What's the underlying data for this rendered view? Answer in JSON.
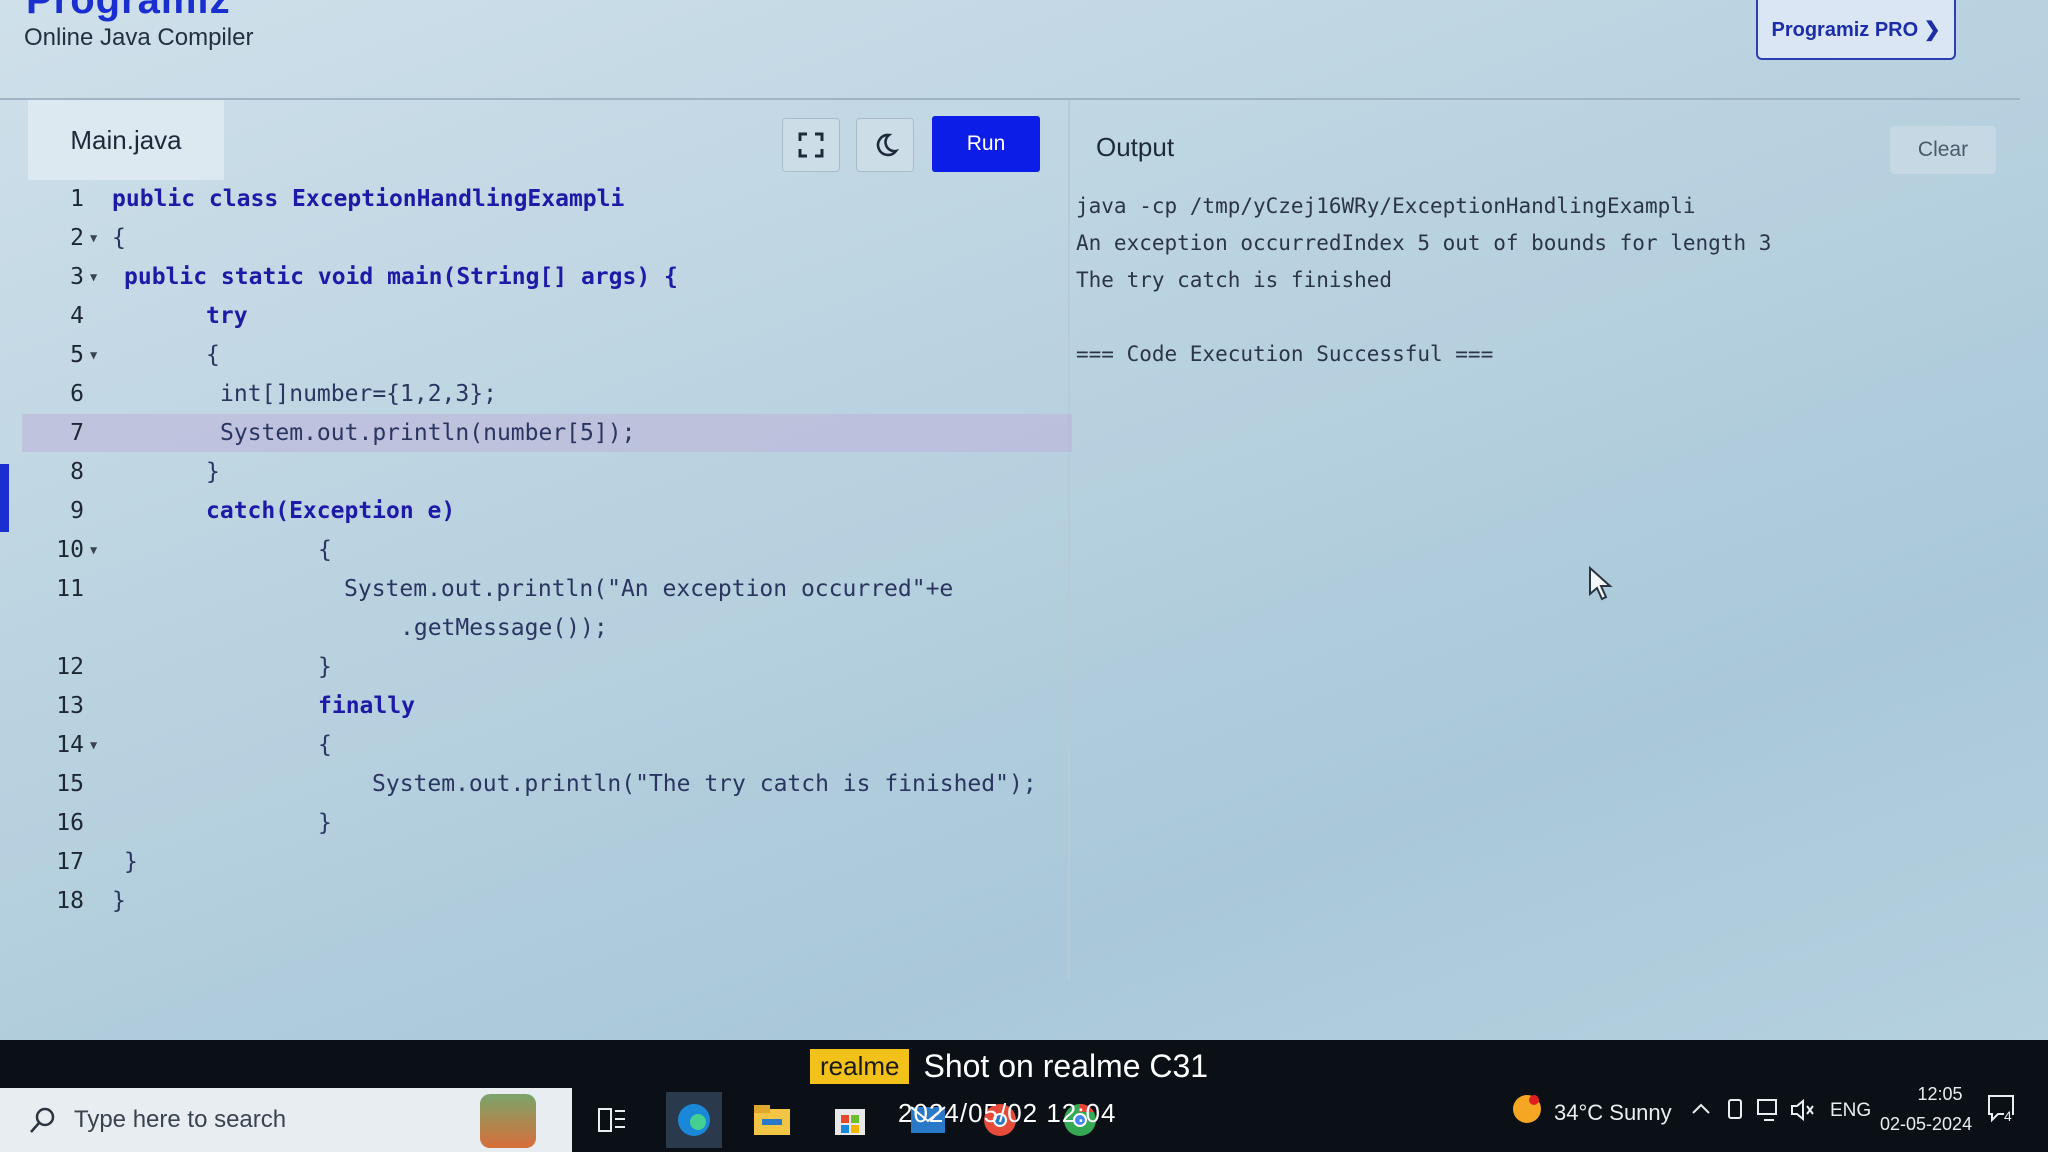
{
  "header": {
    "logo": "Programiz",
    "subtitle": "Online Java Compiler",
    "pro_button": "Programiz PRO ❯"
  },
  "toolbar": {
    "file_tab": "Main.java",
    "fullscreen_icon": "fullscreen-icon",
    "theme_icon": "moon-icon",
    "run_label": "Run",
    "output_label": "Output",
    "clear_label": "Clear"
  },
  "editor": {
    "lines": [
      {
        "n": "1",
        "text": "public class ExceptionHandlingExampli"
      },
      {
        "n": "2",
        "text": "{"
      },
      {
        "n": "3",
        "text": "public static void main(String[] args) {"
      },
      {
        "n": "4",
        "text": "try"
      },
      {
        "n": "5",
        "text": "{"
      },
      {
        "n": "6",
        "text": "int[]number={1,2,3};"
      },
      {
        "n": "7",
        "text": "System.out.println(number[5]);"
      },
      {
        "n": "8",
        "text": "}"
      },
      {
        "n": "9",
        "text": "catch(Exception e)"
      },
      {
        "n": "10",
        "text": "{"
      },
      {
        "n": "11",
        "text": "System.out.println(\"An exception occurred\"+e"
      },
      {
        "n": "",
        "text": ".getMessage());"
      },
      {
        "n": "12",
        "text": "}"
      },
      {
        "n": "13",
        "text": "finally"
      },
      {
        "n": "14",
        "text": "{"
      },
      {
        "n": "15",
        "text": "System.out.println(\"The try catch is finished\");"
      },
      {
        "n": "16",
        "text": "}"
      },
      {
        "n": "17",
        "text": "}"
      },
      {
        "n": "18",
        "text": "}"
      }
    ]
  },
  "output": {
    "lines": [
      "java -cp /tmp/yCzej16WRy/ExceptionHandlingExampli",
      "An exception occurredIndex 5 out of bounds for length 3",
      "The try catch is finished",
      "",
      "=== Code Execution Successful ==="
    ]
  },
  "taskbar": {
    "search_placeholder": "Type here to search",
    "weather": "34°C  Sunny",
    "lang": "ENG",
    "time": "12:05",
    "date": "02-05-2024",
    "notifications": "4"
  },
  "watermark": {
    "brand": "realme",
    "text": "Shot on realme C31",
    "datetime": "2024/05/02  12:04"
  }
}
